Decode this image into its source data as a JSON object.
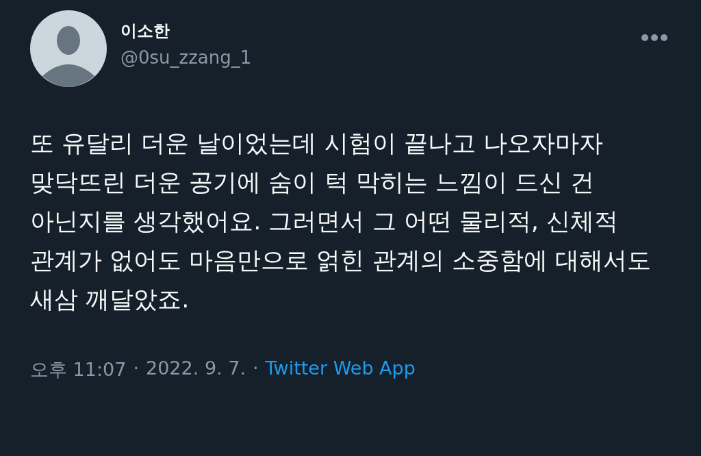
{
  "author": {
    "name": "이소한",
    "handle": "@0su_zzang_1"
  },
  "text": "또 유달리 더운 날이었는데 시험이 끝나고 나오자마자 맞닥뜨린 더운 공기에 숨이 턱 막히는 느낌이 드신 건 아닌지를 생각했어요. 그러면서 그 어떤 물리적, 신체적 관계가 없어도 마음만으로 얽힌 관계의 소중함에 대해서도 새삼 깨달았죠.",
  "meta": {
    "time": "오후 11:07",
    "separator_1": "·",
    "date": "2022. 9. 7.",
    "separator_2": "·",
    "source": "Twitter Web App"
  }
}
